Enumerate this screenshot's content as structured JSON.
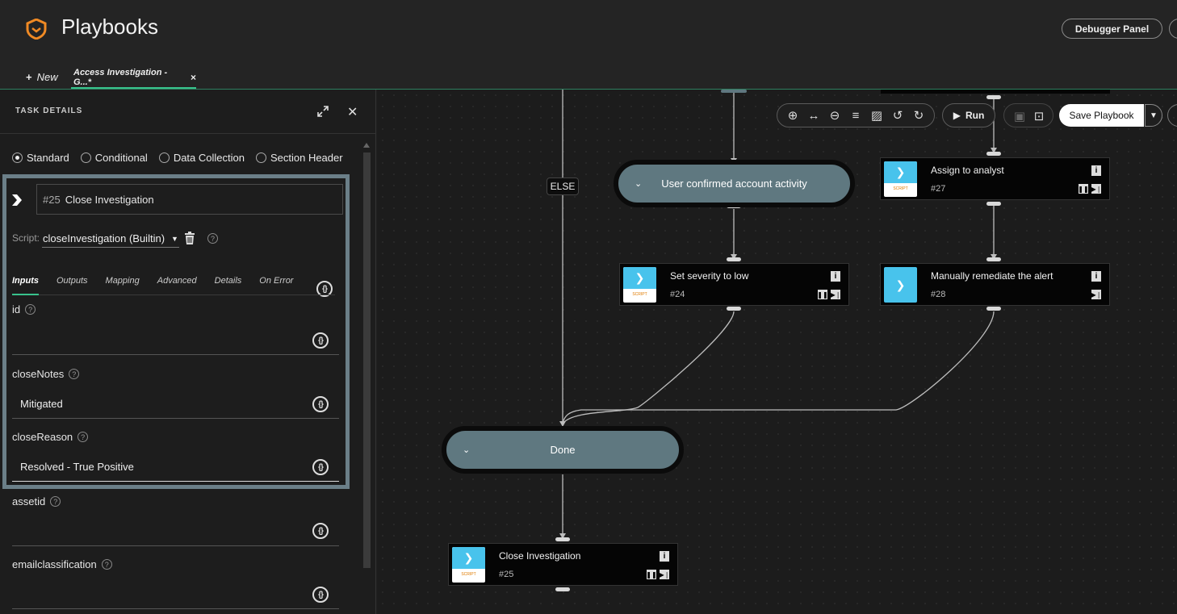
{
  "app": {
    "title": "Playbooks",
    "debugger_label": "Debugger Panel",
    "new_tab_label": "New",
    "active_tab_label": "Access Investigation - G...*"
  },
  "panel": {
    "title": "TASK DETAILS",
    "task_types": [
      "Standard",
      "Conditional",
      "Data Collection",
      "Section Header"
    ],
    "selected_type": "Standard",
    "task_number": "#25",
    "task_name": "Close Investigation",
    "script_label": "Script:",
    "script_value": "closeInvestigation (Builtin)",
    "subtabs": [
      "Inputs",
      "Outputs",
      "Mapping",
      "Advanced",
      "Details",
      "On Error"
    ],
    "active_subtab": "Inputs",
    "fields": [
      {
        "label": "id",
        "value": ""
      },
      {
        "label": "closeNotes",
        "value": "Mitigated"
      },
      {
        "label": "closeReason",
        "value": "Resolved - True Positive"
      },
      {
        "label": "assetid",
        "value": ""
      },
      {
        "label": "emailclassification",
        "value": ""
      }
    ]
  },
  "toolbar": {
    "run_label": "Run",
    "save_label": "Save Playbook"
  },
  "canvas": {
    "else_label": "ELSE",
    "conditions": [
      {
        "label": "User confirmed account activity"
      },
      {
        "label": "Done"
      }
    ],
    "tasks": [
      {
        "name": "Assign to analyst",
        "id": "#27",
        "kind": "script"
      },
      {
        "name": "Set severity to low",
        "id": "#24",
        "kind": "script"
      },
      {
        "name": "Manually remediate the alert",
        "id": "#28",
        "kind": "manual"
      },
      {
        "name": "Close Investigation",
        "id": "#25",
        "kind": "script"
      }
    ],
    "script_tag": "SCRIPT"
  }
}
